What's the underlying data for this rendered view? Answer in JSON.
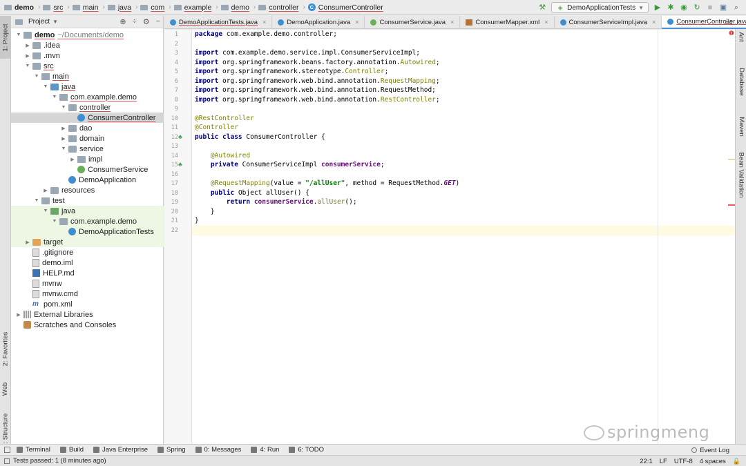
{
  "breadcrumbs": [
    "demo",
    "src",
    "main",
    "java",
    "com",
    "example",
    "demo",
    "controller",
    "ConsumerController"
  ],
  "run_config": {
    "label": "DemoApplicationTests"
  },
  "left_tabs": {
    "project": "1: Project",
    "favorites": "2: Favorites",
    "web": "Web",
    "structure": "Z: Structure"
  },
  "right_tabs": {
    "ant": "Ant",
    "database": "Database",
    "maven": "Maven",
    "bean": "Bean Validation"
  },
  "project_panel": {
    "title": "Project"
  },
  "tree": [
    {
      "label": "demo",
      "path": "~/Documents/demo",
      "indent": 0,
      "arrow": "down",
      "icon": "fold",
      "bold": true,
      "underline": true
    },
    {
      "label": ".idea",
      "indent": 1,
      "arrow": "right",
      "icon": "fold"
    },
    {
      "label": ".mvn",
      "indent": 1,
      "arrow": "right",
      "icon": "fold"
    },
    {
      "label": "src",
      "indent": 1,
      "arrow": "down",
      "icon": "fold",
      "underline": true
    },
    {
      "label": "main",
      "indent": 2,
      "arrow": "down",
      "icon": "fold",
      "underline": true
    },
    {
      "label": "java",
      "indent": 3,
      "arrow": "down",
      "icon": "fold src",
      "underline": true
    },
    {
      "label": "com.example.demo",
      "indent": 4,
      "arrow": "down",
      "icon": "fold pkg",
      "underline": true
    },
    {
      "label": "controller",
      "indent": 5,
      "arrow": "down",
      "icon": "fold pkg",
      "underline": true
    },
    {
      "label": "ConsumerController",
      "indent": 6,
      "arrow": "",
      "icon": "cls",
      "underline": true,
      "selected": true
    },
    {
      "label": "dao",
      "indent": 5,
      "arrow": "right",
      "icon": "fold pkg"
    },
    {
      "label": "domain",
      "indent": 5,
      "arrow": "right",
      "icon": "fold pkg"
    },
    {
      "label": "service",
      "indent": 5,
      "arrow": "down",
      "icon": "fold pkg"
    },
    {
      "label": "impl",
      "indent": 6,
      "arrow": "right",
      "icon": "fold pkg"
    },
    {
      "label": "ConsumerService",
      "indent": 6,
      "arrow": "",
      "icon": "intf"
    },
    {
      "label": "DemoApplication",
      "indent": 5,
      "arrow": "",
      "icon": "cls"
    },
    {
      "label": "resources",
      "indent": 3,
      "arrow": "right",
      "icon": "fold"
    },
    {
      "label": "test",
      "indent": 2,
      "arrow": "down",
      "icon": "fold"
    },
    {
      "label": "java",
      "indent": 3,
      "arrow": "down",
      "icon": "fold test",
      "test": true
    },
    {
      "label": "com.example.demo",
      "indent": 4,
      "arrow": "down",
      "icon": "fold pkg",
      "test": true
    },
    {
      "label": "DemoApplicationTests",
      "indent": 5,
      "arrow": "",
      "icon": "cls",
      "test": true
    },
    {
      "label": "target",
      "indent": 1,
      "arrow": "right",
      "icon": "fold orange",
      "test": true
    },
    {
      "label": ".gitignore",
      "indent": 1,
      "arrow": "",
      "icon": "file"
    },
    {
      "label": "demo.iml",
      "indent": 1,
      "arrow": "",
      "icon": "file"
    },
    {
      "label": "HELP.md",
      "indent": 1,
      "arrow": "",
      "icon": "md"
    },
    {
      "label": "mvnw",
      "indent": 1,
      "arrow": "",
      "icon": "file"
    },
    {
      "label": "mvnw.cmd",
      "indent": 1,
      "arrow": "",
      "icon": "file"
    },
    {
      "label": "pom.xml",
      "indent": 1,
      "arrow": "",
      "icon": "xml"
    },
    {
      "label": "External Libraries",
      "indent": 0,
      "arrow": "right",
      "icon": "lib"
    },
    {
      "label": "Scratches and Consoles",
      "indent": 0,
      "arrow": "",
      "icon": "scratch"
    }
  ],
  "tabs": [
    {
      "label": "DemoApplicationTests.java",
      "icon": "tc",
      "underline": true
    },
    {
      "label": "DemoApplication.java",
      "icon": "tc"
    },
    {
      "label": "ConsumerService.java",
      "icon": "ti"
    },
    {
      "label": "ConsumerMapper.xml",
      "icon": "tx"
    },
    {
      "label": "ConsumerServiceImpl.java",
      "icon": "tc"
    },
    {
      "label": "ConsumerController.java",
      "icon": "tc",
      "active": true,
      "underline": true
    }
  ],
  "tabs_more": "4",
  "code_lines": [
    [
      [
        "kw",
        "package "
      ],
      [
        "pl",
        "com.example.demo.controller;"
      ]
    ],
    [],
    [
      [
        "kw",
        "import "
      ],
      [
        "pl",
        "com.example.demo.service.impl.ConsumerServiceImpl;"
      ]
    ],
    [
      [
        "kw",
        "import "
      ],
      [
        "pl",
        "org.springframework.beans.factory.annotation."
      ],
      [
        "an",
        "Autowired"
      ],
      [
        "pl",
        ";"
      ]
    ],
    [
      [
        "kw",
        "import "
      ],
      [
        "pl",
        "org.springframework.stereotype."
      ],
      [
        "an",
        "Controller"
      ],
      [
        "pl",
        ";"
      ]
    ],
    [
      [
        "kw",
        "import "
      ],
      [
        "pl",
        "org.springframework.web.bind.annotation."
      ],
      [
        "an",
        "RequestMapping"
      ],
      [
        "pl",
        ";"
      ]
    ],
    [
      [
        "kw",
        "import "
      ],
      [
        "pl",
        "org.springframework.web.bind.annotation.RequestMethod;"
      ]
    ],
    [
      [
        "kw",
        "import "
      ],
      [
        "pl",
        "org.springframework.web.bind.annotation."
      ],
      [
        "an",
        "RestController"
      ],
      [
        "pl",
        ";"
      ]
    ],
    [],
    [
      [
        "an",
        "@RestController"
      ]
    ],
    [
      [
        "an",
        "@Controller"
      ]
    ],
    [
      [
        "kw",
        "public class "
      ],
      [
        "pl",
        "ConsumerController {"
      ]
    ],
    [],
    [
      [
        "pl",
        "    "
      ],
      [
        "an",
        "@Autowired"
      ]
    ],
    [
      [
        "pl",
        "    "
      ],
      [
        "kw",
        "private "
      ],
      [
        "pl",
        "ConsumerServiceImpl "
      ],
      [
        "fd",
        "consumerService"
      ],
      [
        "pl",
        ";"
      ]
    ],
    [],
    [
      [
        "pl",
        "    "
      ],
      [
        "an",
        "@RequestMapping"
      ],
      [
        "pl",
        "(value = "
      ],
      [
        "st",
        "\"/allUser\""
      ],
      [
        "pl",
        ", method = RequestMethod."
      ],
      [
        "it",
        "GET"
      ],
      [
        "pl",
        ")"
      ]
    ],
    [
      [
        "pl",
        "    "
      ],
      [
        "kw",
        "public "
      ],
      [
        "pl",
        "Object allUser() {"
      ]
    ],
    [
      [
        "pl",
        "        "
      ],
      [
        "kw",
        "return "
      ],
      [
        "fd",
        "consumerService"
      ],
      [
        "pl",
        "."
      ],
      [
        "mc",
        "allUser"
      ],
      [
        "pl",
        "();"
      ]
    ],
    [
      [
        "pl",
        "    }"
      ]
    ],
    [
      [
        "pl",
        "}"
      ]
    ],
    []
  ],
  "watermark": "springmeng",
  "bottom_tools": [
    {
      "label": "Terminal"
    },
    {
      "label": "Build"
    },
    {
      "label": "Java Enterprise"
    },
    {
      "label": "Spring"
    },
    {
      "label": "0: Messages"
    },
    {
      "label": "4: Run"
    },
    {
      "label": "6: TODO"
    }
  ],
  "event_log": "Event Log",
  "status": {
    "message": "Tests passed: 1 (8 minutes ago)",
    "position": "22:1",
    "line_sep": "LF",
    "encoding": "UTF-8",
    "indent": "4 spaces"
  },
  "colors": {
    "accent": "#4a90d9",
    "selection": "#d6d6d6",
    "current_line": "#fffbe2",
    "test_bg": "#edf7e4"
  }
}
